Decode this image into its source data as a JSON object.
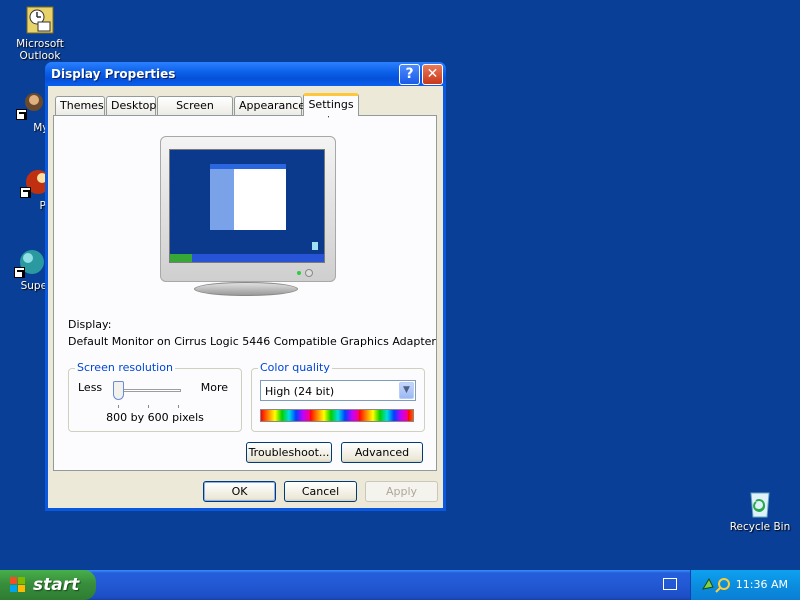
{
  "desktop": {
    "icons": [
      {
        "label": "Microsoft Outlook",
        "icon": "outlook-icon"
      },
      {
        "label": "MyPa",
        "icon": "mypc-icon"
      },
      {
        "label": "Peg",
        "icon": "pegasus-icon"
      },
      {
        "label": "Superm",
        "icon": "superman-icon"
      },
      {
        "label": "Recycle Bin",
        "icon": "recycle-bin-icon"
      }
    ]
  },
  "window": {
    "title": "Display Properties",
    "help_glyph": "?",
    "close_glyph": "✕",
    "tabs": [
      "Themes",
      "Desktop",
      "Screen Saver",
      "Appearance",
      "Settings"
    ],
    "active_tab": "Settings",
    "display_label": "Display:",
    "display_value": "Default Monitor on Cirrus Logic 5446 Compatible Graphics Adapter",
    "resolution": {
      "legend": "Screen resolution",
      "less": "Less",
      "more": "More",
      "value_text": "800 by 600 pixels"
    },
    "color": {
      "legend": "Color quality",
      "selected": "High (24 bit)"
    },
    "buttons": {
      "troubleshoot": "Troubleshoot...",
      "advanced": "Advanced",
      "ok": "OK",
      "cancel": "Cancel",
      "apply": "Apply"
    }
  },
  "taskbar": {
    "start": "start",
    "clock": "11:36 AM"
  },
  "colors": {
    "desktop": "#0a3f97",
    "title_bar": "#0a5fe8",
    "tab_highlight": "#ffc83c",
    "group_legend": "#0046d5",
    "start_green": "#388e3c"
  }
}
